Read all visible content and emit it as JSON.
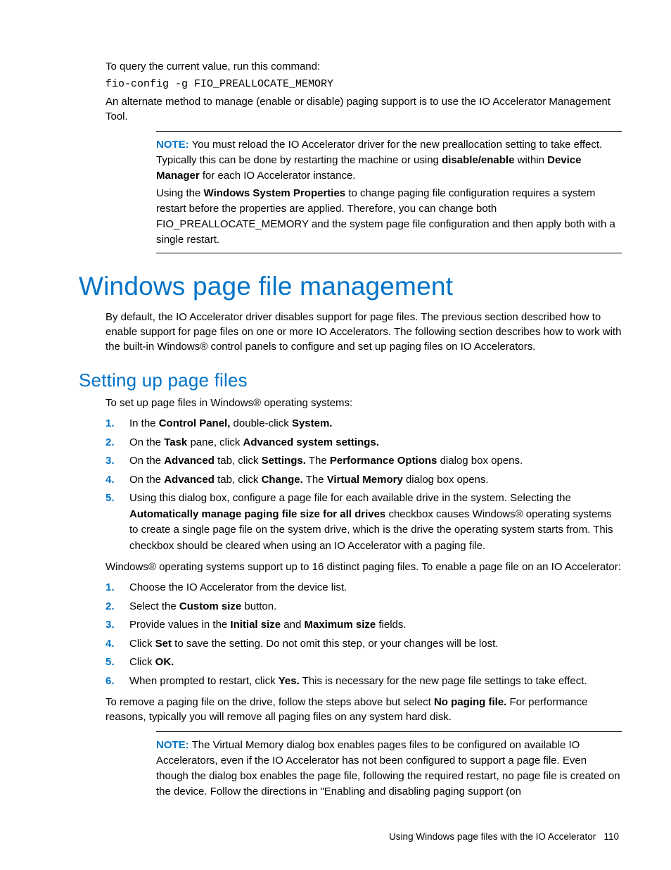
{
  "intro": {
    "p1": "To query the current value, run this command:",
    "code": "fio-config -g FIO_PREALLOCATE_MEMORY",
    "p2": "An alternate method to manage (enable or disable) paging support is to use the IO Accelerator Management Tool."
  },
  "note1": {
    "label": "NOTE:",
    "p1a": " You must reload the IO Accelerator driver for the new preallocation setting to take effect. Typically this can be done by restarting the machine or using ",
    "p1b": "disable/enable",
    "p1c": " within ",
    "p1d": "Device Manager",
    "p1e": " for each IO Accelerator instance.",
    "p2a": "Using the ",
    "p2b": "Windows System Properties",
    "p2c": " to change paging file configuration requires a system restart before the properties are applied. Therefore, you can change both FIO_PREALLOCATE_MEMORY and the system page file configuration and then apply both with a single restart."
  },
  "h1": "Windows page file management",
  "h1_body": "By default, the IO Accelerator driver disables support for page files. The previous section described how to enable support for page files on one or more IO Accelerators. The following section describes how to work with the built-in Windows® control panels to configure and set up paging files on IO Accelerators.",
  "h2": "Setting up page files",
  "h2_intro": "To set up page files in Windows® operating systems:",
  "list1": {
    "n1": "1.",
    "i1a": "In the ",
    "i1b": "Control Panel,",
    "i1c": " double-click ",
    "i1d": "System.",
    "n2": "2.",
    "i2a": "On the ",
    "i2b": "Task",
    "i2c": " pane, click ",
    "i2d": "Advanced system settings.",
    "n3": "3.",
    "i3a": "On the ",
    "i3b": "Advanced",
    "i3c": " tab, click ",
    "i3d": "Settings.",
    "i3e": " The ",
    "i3f": "Performance Options",
    "i3g": " dialog box opens.",
    "n4": "4.",
    "i4a": "On the ",
    "i4b": "Advanced",
    "i4c": " tab, click ",
    "i4d": "Change.",
    "i4e": " The ",
    "i4f": "Virtual Memory",
    "i4g": " dialog box opens.",
    "n5": "5.",
    "i5a": "Using this dialog box, configure a page file for each available drive in the system. Selecting the ",
    "i5b": "Automatically manage paging file size for all drives",
    "i5c": " checkbox causes Windows® operating systems to create a single page file on the system drive, which is the drive the operating system starts from. This checkbox should be cleared when using an IO Accelerator with a paging file."
  },
  "mid_p": "Windows® operating systems support up to 16 distinct paging files. To enable a page file on an IO Accelerator:",
  "list2": {
    "n1": "1.",
    "i1": "Choose the IO Accelerator from the device list.",
    "n2": "2.",
    "i2a": "Select the ",
    "i2b": "Custom size",
    "i2c": " button.",
    "n3": "3.",
    "i3a": "Provide values in the ",
    "i3b": "Initial size",
    "i3c": " and ",
    "i3d": "Maximum size",
    "i3e": " fields.",
    "n4": "4.",
    "i4a": "Click ",
    "i4b": "Set",
    "i4c": " to save the setting. Do not omit this step, or your changes will be lost.",
    "n5": "5.",
    "i5a": "Click ",
    "i5b": "OK.",
    "n6": "6.",
    "i6a": "When prompted to restart, click ",
    "i6b": "Yes.",
    "i6c": " This is necessary for the new page file settings to take effect."
  },
  "remove_p": {
    "a": "To remove a paging file on the drive, follow the steps above but select ",
    "b": "No paging file.",
    "c": " For performance reasons, typically you will remove all paging files on any system hard disk."
  },
  "note2": {
    "label": "NOTE:",
    "text": " The Virtual Memory dialog box enables pages files to be configured on available IO Accelerators, even if the IO Accelerator has not been configured to support a page file. Even though the dialog box enables the page file, following the required restart, no page file is created on the device. Follow the directions in \"Enabling and disabling paging support (on"
  },
  "footer": {
    "text": "Using Windows page files with the IO Accelerator",
    "page": "110"
  }
}
